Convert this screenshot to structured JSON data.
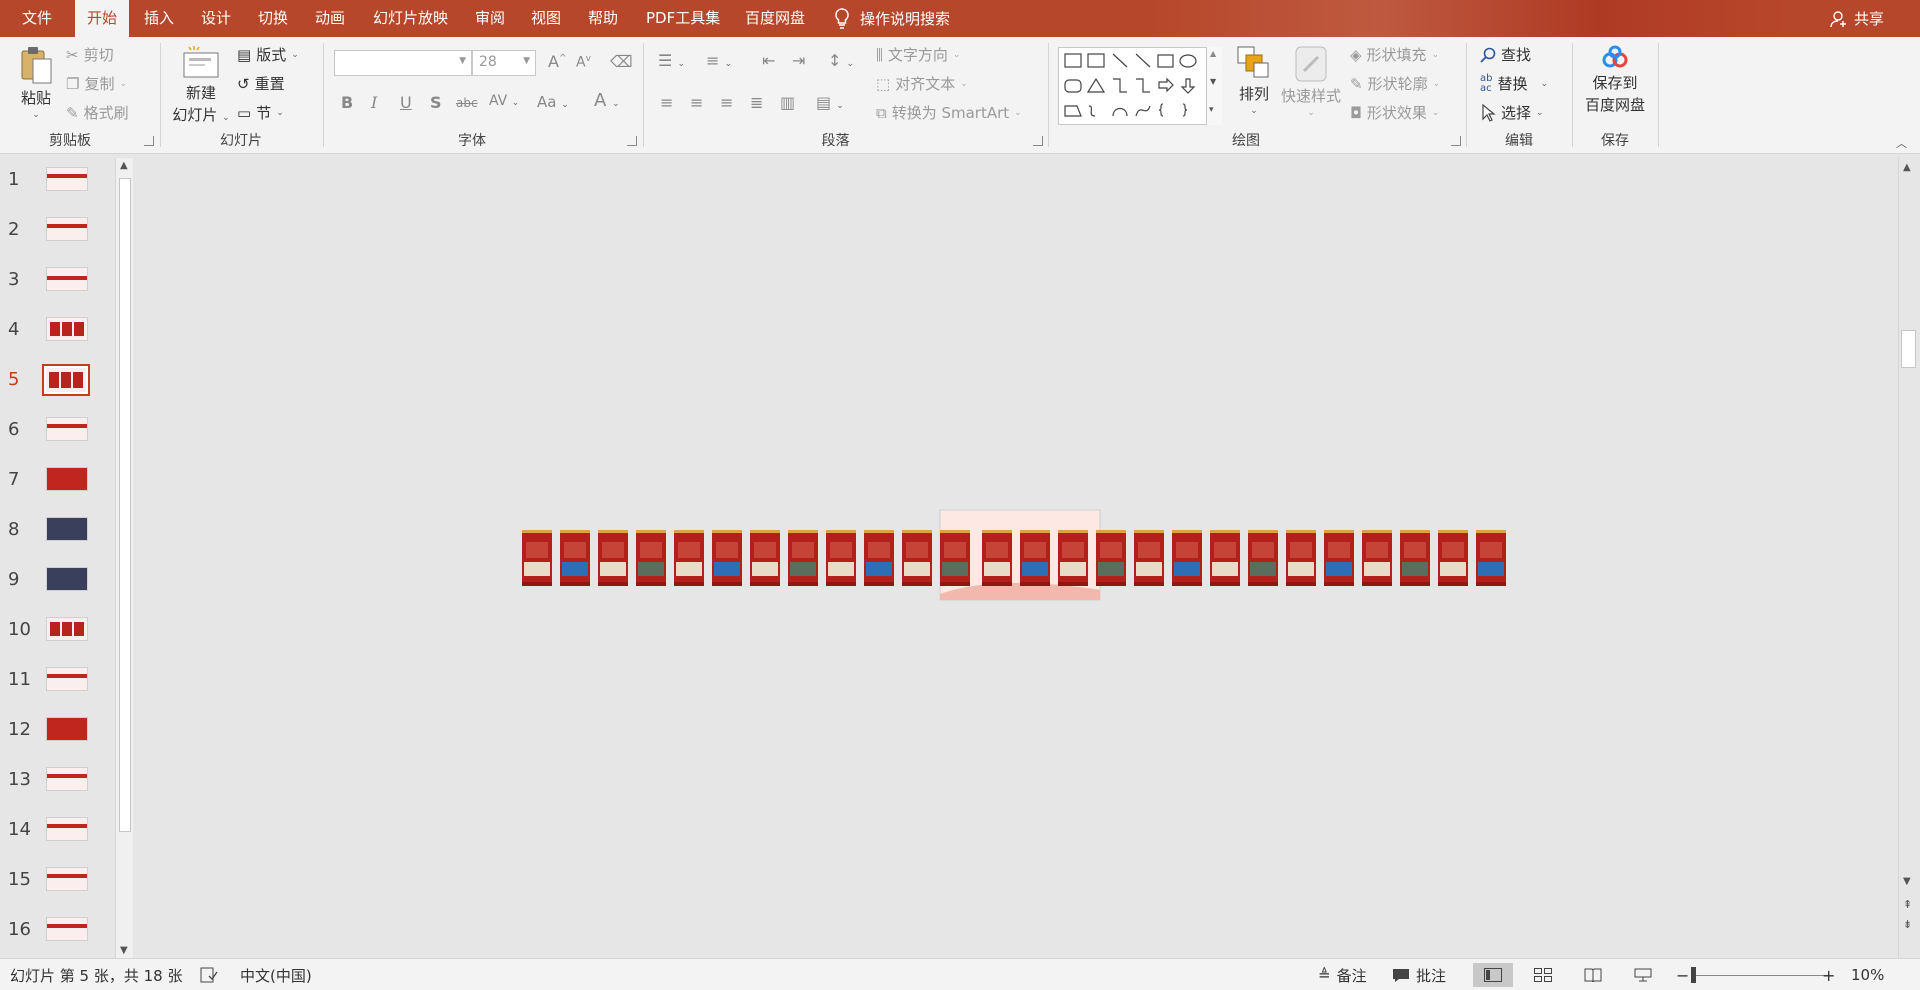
{
  "menu": {
    "tabs": [
      "文件",
      "开始",
      "插入",
      "设计",
      "切换",
      "动画",
      "幻灯片放映",
      "审阅",
      "视图",
      "帮助",
      "PDF工具集",
      "百度网盘"
    ],
    "active_tab": "开始",
    "tell_me": "操作说明搜索",
    "share": "共享"
  },
  "ribbon": {
    "clipboard": {
      "label": "剪贴板",
      "paste": "粘贴",
      "cut": "剪切",
      "copy": "复制",
      "format_painter": "格式刷"
    },
    "slides": {
      "label": "幻灯片",
      "new_slide_line1": "新建",
      "new_slide_line2": "幻灯片",
      "layout": "版式",
      "reset": "重置",
      "section": "节"
    },
    "font": {
      "label": "字体",
      "font_name": "",
      "font_size": "28",
      "grow": "A",
      "shrink": "A",
      "bold": "B",
      "italic": "I",
      "underline": "U",
      "shadow": "S",
      "strike": "abc",
      "spacing": "AV",
      "case": "Aa",
      "color": "A"
    },
    "paragraph": {
      "label": "段落",
      "text_direction": "文字方向",
      "align_text": "对齐文本",
      "smartart": "转换为 SmartArt"
    },
    "drawing": {
      "label": "绘图",
      "arrange": "排列",
      "quick_styles": "快速样式",
      "shape_fill": "形状填充",
      "shape_outline": "形状轮廓",
      "shape_effects": "形状效果"
    },
    "editing": {
      "label": "编辑",
      "find": "查找",
      "replace": "替换",
      "select": "选择"
    },
    "save": {
      "label": "保存",
      "save_line1": "保存到",
      "save_line2": "百度网盘"
    }
  },
  "slides_panel": {
    "numbers": [
      "1",
      "2",
      "3",
      "4",
      "5",
      "6",
      "7",
      "8",
      "9",
      "10",
      "11",
      "12",
      "13",
      "14",
      "15",
      "16"
    ],
    "selected": 5
  },
  "editor": {
    "strip_count": 26,
    "selected_index": 11,
    "colors": {
      "slide_red": "#b3201c",
      "gold": "#d9a441",
      "accent": "#c43e1c"
    }
  },
  "status": {
    "slide_info": "幻灯片 第 5 张，共 18 张",
    "language": "中文(中国)",
    "notes": "备注",
    "comments": "批注",
    "zoom_minus": "−",
    "zoom_plus": "+",
    "zoom": "10%"
  }
}
